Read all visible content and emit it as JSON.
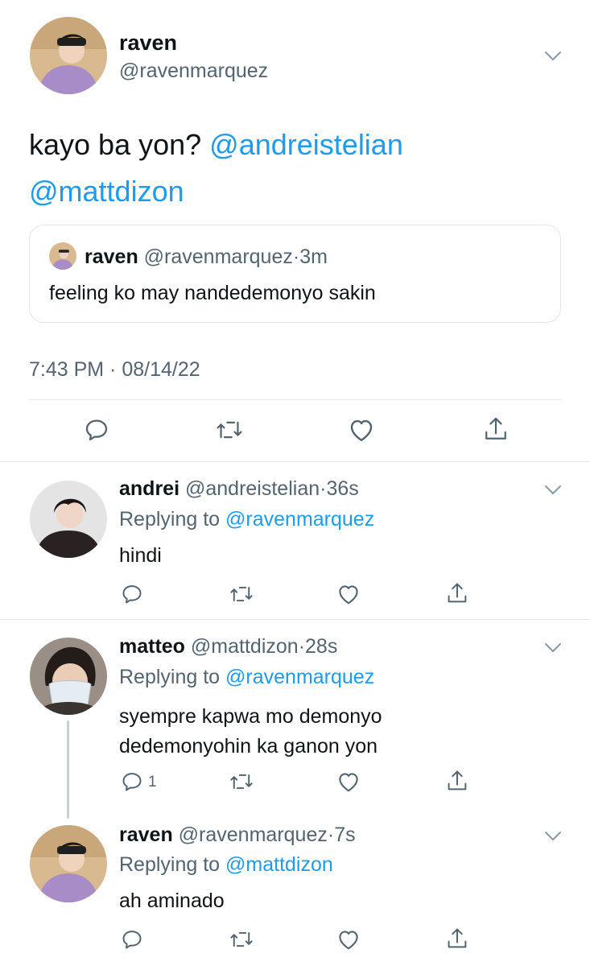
{
  "main_tweet": {
    "author_name": "raven",
    "author_handle": "@ravenmarquez",
    "text_before": "kayo ba yon?",
    "mention_1": "@andreistelian",
    "mention_2": "@mattdizon",
    "quote": {
      "author_name": "raven",
      "author_handle": "@ravenmarquez",
      "sep": "·",
      "time": "3m",
      "text": "feeling ko may nandedemonyo sakin"
    },
    "timestamp": "7:43 PM · 08/14/22"
  },
  "replies": [
    {
      "author_name": "andrei",
      "author_handle": "@andreistelian",
      "sep": "·",
      "time": "36s",
      "replying_prefix": "Replying to",
      "replying_to": "@ravenmarquez",
      "text": "hindi"
    },
    {
      "author_name": "matteo",
      "author_handle": "@mattdizon",
      "sep": "·",
      "time": "28s",
      "replying_prefix": "Replying to",
      "replying_to": "@ravenmarquez",
      "text_line_1": "syempre kapwa mo demonyo",
      "text_line_2": "dedemonyohin ka ganon yon",
      "reply_count": "1"
    },
    {
      "author_name": "raven",
      "author_handle": "@ravenmarquez",
      "sep": "·",
      "time": "7s",
      "replying_prefix": "Replying to",
      "replying_to": "@mattdizon",
      "text": "ah aminado"
    }
  ],
  "icons": [
    "reply-icon",
    "retweet-icon",
    "like-icon",
    "share-icon",
    "chevron-down-icon"
  ],
  "colors": {
    "link": "#1d9bf0",
    "secondary_text": "#536471",
    "icon": "#536471",
    "divider": "#e6e9ec"
  }
}
